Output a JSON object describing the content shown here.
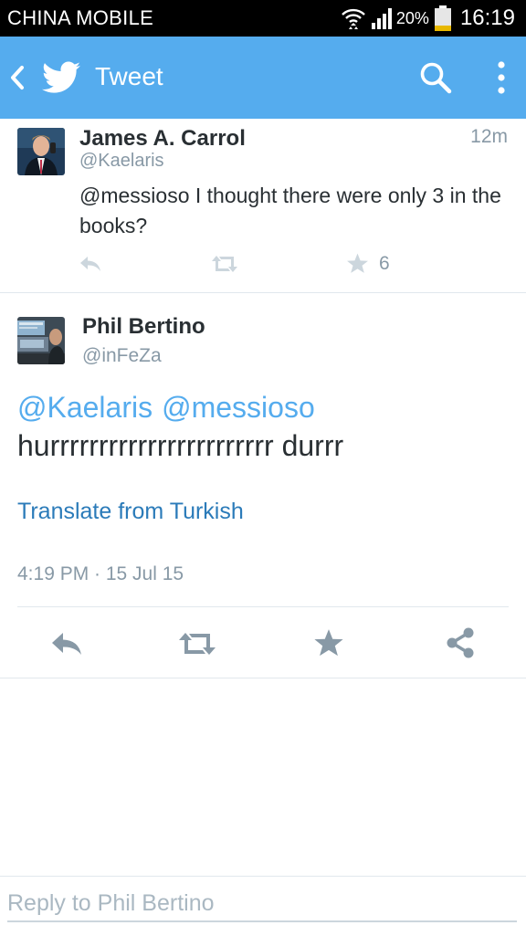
{
  "status_bar": {
    "carrier": "CHINA MOBILE",
    "battery_percent": "20%",
    "time": "16:19"
  },
  "action_bar": {
    "title": "Tweet",
    "icons": [
      "back-icon",
      "twitter-bird-icon",
      "search-icon",
      "overflow-menu-icon"
    ]
  },
  "parent_tweet": {
    "author_name": "James A. Carrol",
    "handle": "@Kaelaris",
    "time_ago": "12m",
    "text": "@messioso I thought there were only 3 in the books?",
    "favorite_count": "6"
  },
  "focused_tweet": {
    "author_name": "Phil Bertino",
    "handle": "@inFeZa",
    "mentions": [
      "@Kaelaris",
      "@messioso"
    ],
    "body": "hurrrrrrrrrrrrrrrrrrrrrrr durrr",
    "translate_label": "Translate from Turkish",
    "timestamp": "4:19 PM · 15 Jul 15"
  },
  "reply": {
    "placeholder": "Reply to Phil Bertino",
    "value": ""
  },
  "colors": {
    "accent": "#55acee",
    "link": "#2b7bb9",
    "muted": "#8899a6",
    "text": "#292f33",
    "divider": "#e1e8ed"
  }
}
